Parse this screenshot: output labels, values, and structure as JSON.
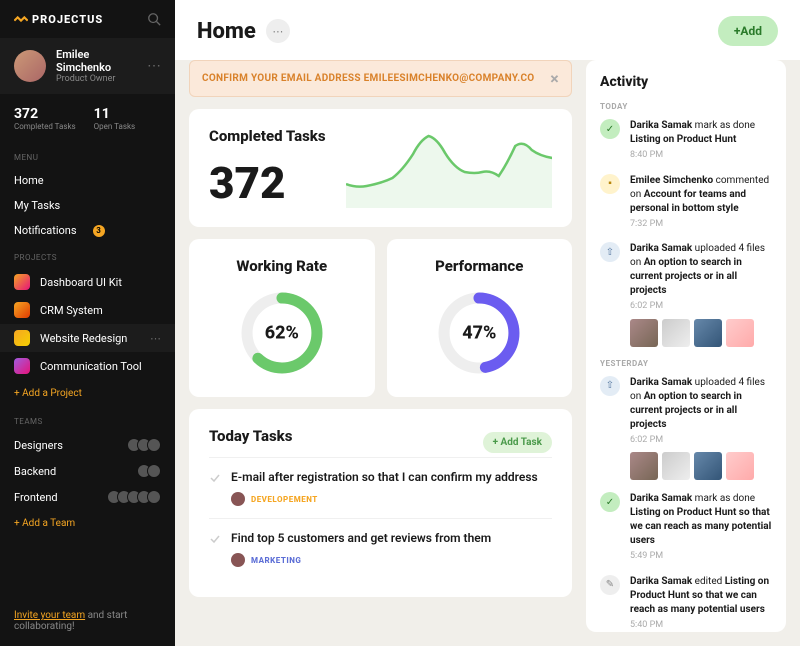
{
  "brand": "PROJECTUS",
  "user": {
    "name": "Emilee Simchenko",
    "role": "Product Owner"
  },
  "stats": {
    "completed_n": "372",
    "completed_lbl": "Completed Tasks",
    "open_n": "11",
    "open_lbl": "Open Tasks"
  },
  "nav": {
    "menu_lbl": "MENU",
    "home": "Home",
    "my_tasks": "My Tasks",
    "notifications": "Notifications",
    "notifications_badge": "3"
  },
  "projects": {
    "lbl": "PROJECTS",
    "items": [
      "Dashboard UI Kit",
      "CRM System",
      "Website Redesign",
      "Communication Tool"
    ],
    "add": "+ Add a Project"
  },
  "teams": {
    "lbl": "TEAMS",
    "items": [
      "Designers",
      "Backend",
      "Frontend"
    ],
    "add": "+ Add a Team"
  },
  "footer": {
    "invite": "Invite your team",
    "rest": " and start collaborating!"
  },
  "header": {
    "title": "Home",
    "add": "+Add"
  },
  "alert": {
    "text": "CONFIRM YOUR EMAIL ADDRESS EMILEESIMCHENKO@COMPANY.CO"
  },
  "completed": {
    "title": "Completed Tasks",
    "value": "372"
  },
  "working_rate": {
    "title": "Working Rate",
    "value": "62%"
  },
  "performance": {
    "title": "Performance",
    "value": "47%"
  },
  "today_tasks": {
    "title": "Today Tasks",
    "add": "+ Add Task",
    "items": [
      {
        "title": "E-mail after registration so that I can confirm my address",
        "tag": "DEVELOPEMENT",
        "tag_cls": "dev"
      },
      {
        "title": "Find top 5 customers and get reviews from them",
        "tag": "MARKETING",
        "tag_cls": "mkt"
      }
    ]
  },
  "activity": {
    "title": "Activity",
    "today_lbl": "TODAY",
    "yesterday_lbl": "YESTERDAY",
    "today": [
      {
        "icon": "done",
        "actor": "Darika Samak",
        "verb": " mark as done ",
        "obj": "Listing on Product Hunt",
        "time": "8:40 PM"
      },
      {
        "icon": "comment",
        "actor": "Emilee Simchenko",
        "verb": " commented on ",
        "obj": "Account for teams and personal in bottom style",
        "time": "7:32 PM"
      },
      {
        "icon": "upload",
        "actor": "Darika Samak",
        "verb": " uploaded 4 files on ",
        "obj": "An option to search in current projects or in all projects",
        "time": "6:02 PM",
        "thumbs": 4
      }
    ],
    "yesterday": [
      {
        "icon": "upload",
        "actor": "Darika Samak",
        "verb": " uploaded 4 files on ",
        "obj": "An option to search in current projects or in all projects",
        "time": "6:02 PM",
        "thumbs": 4
      },
      {
        "icon": "done",
        "actor": "Darika Samak",
        "verb": " mark as done ",
        "obj": "Listing on Product Hunt so that we can reach as many potential users",
        "time": "5:49 PM"
      },
      {
        "icon": "edit",
        "actor": "Darika Samak",
        "verb": " edited ",
        "obj": "Listing on Product Hunt so that we can reach as many potential users",
        "time": "5:40 PM"
      }
    ]
  },
  "chart_data": {
    "completed_spark": {
      "type": "area",
      "x": [
        0,
        1,
        2,
        3,
        4,
        5,
        6,
        7,
        8,
        9,
        10,
        11
      ],
      "values": [
        0.3,
        0.25,
        0.35,
        0.6,
        0.92,
        0.68,
        0.45,
        0.48,
        0.4,
        0.6,
        0.82,
        0.65
      ]
    },
    "working_rate": {
      "type": "gauge",
      "value": 62,
      "max": 100,
      "color": "#6bc96b"
    },
    "performance": {
      "type": "gauge",
      "value": 47,
      "max": 100,
      "color": "#6b5cf0"
    }
  }
}
